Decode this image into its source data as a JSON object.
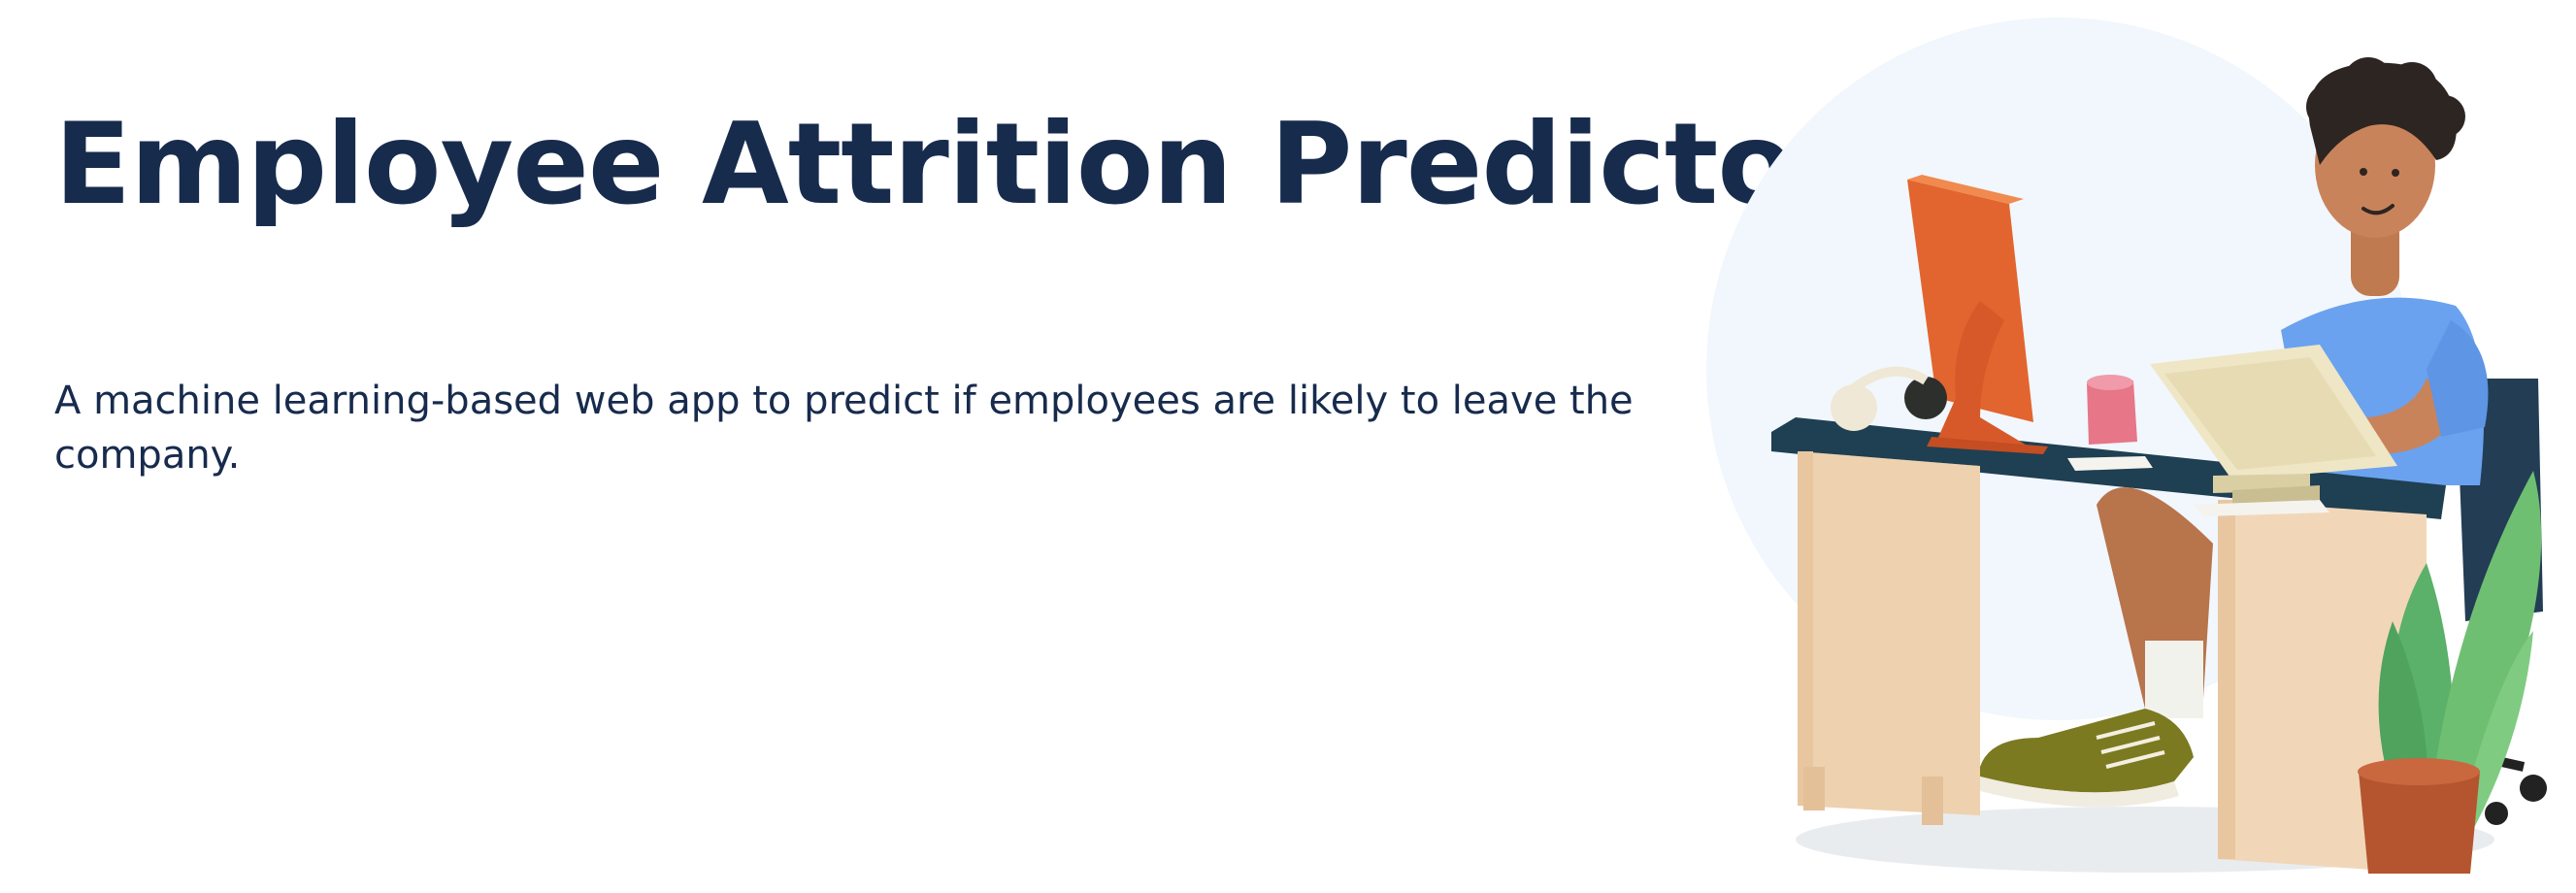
{
  "hero": {
    "title": "Employee Attrition Predictor",
    "subtitle": "A machine learning-based web app to predict if employees are likely to leave the company."
  },
  "illustration": {
    "icon": "person-at-desk-illustration"
  },
  "colors": {
    "title_text": "#172b4d",
    "background": "#ffffff",
    "circle": "#f1f7fc",
    "desk_top": "#1f3f52",
    "desk_body": "#f1d7b8",
    "monitor": "#e2652f",
    "shirt": "#6aa2ef",
    "plant": "#6fbf73",
    "pot": "#b4552f"
  }
}
